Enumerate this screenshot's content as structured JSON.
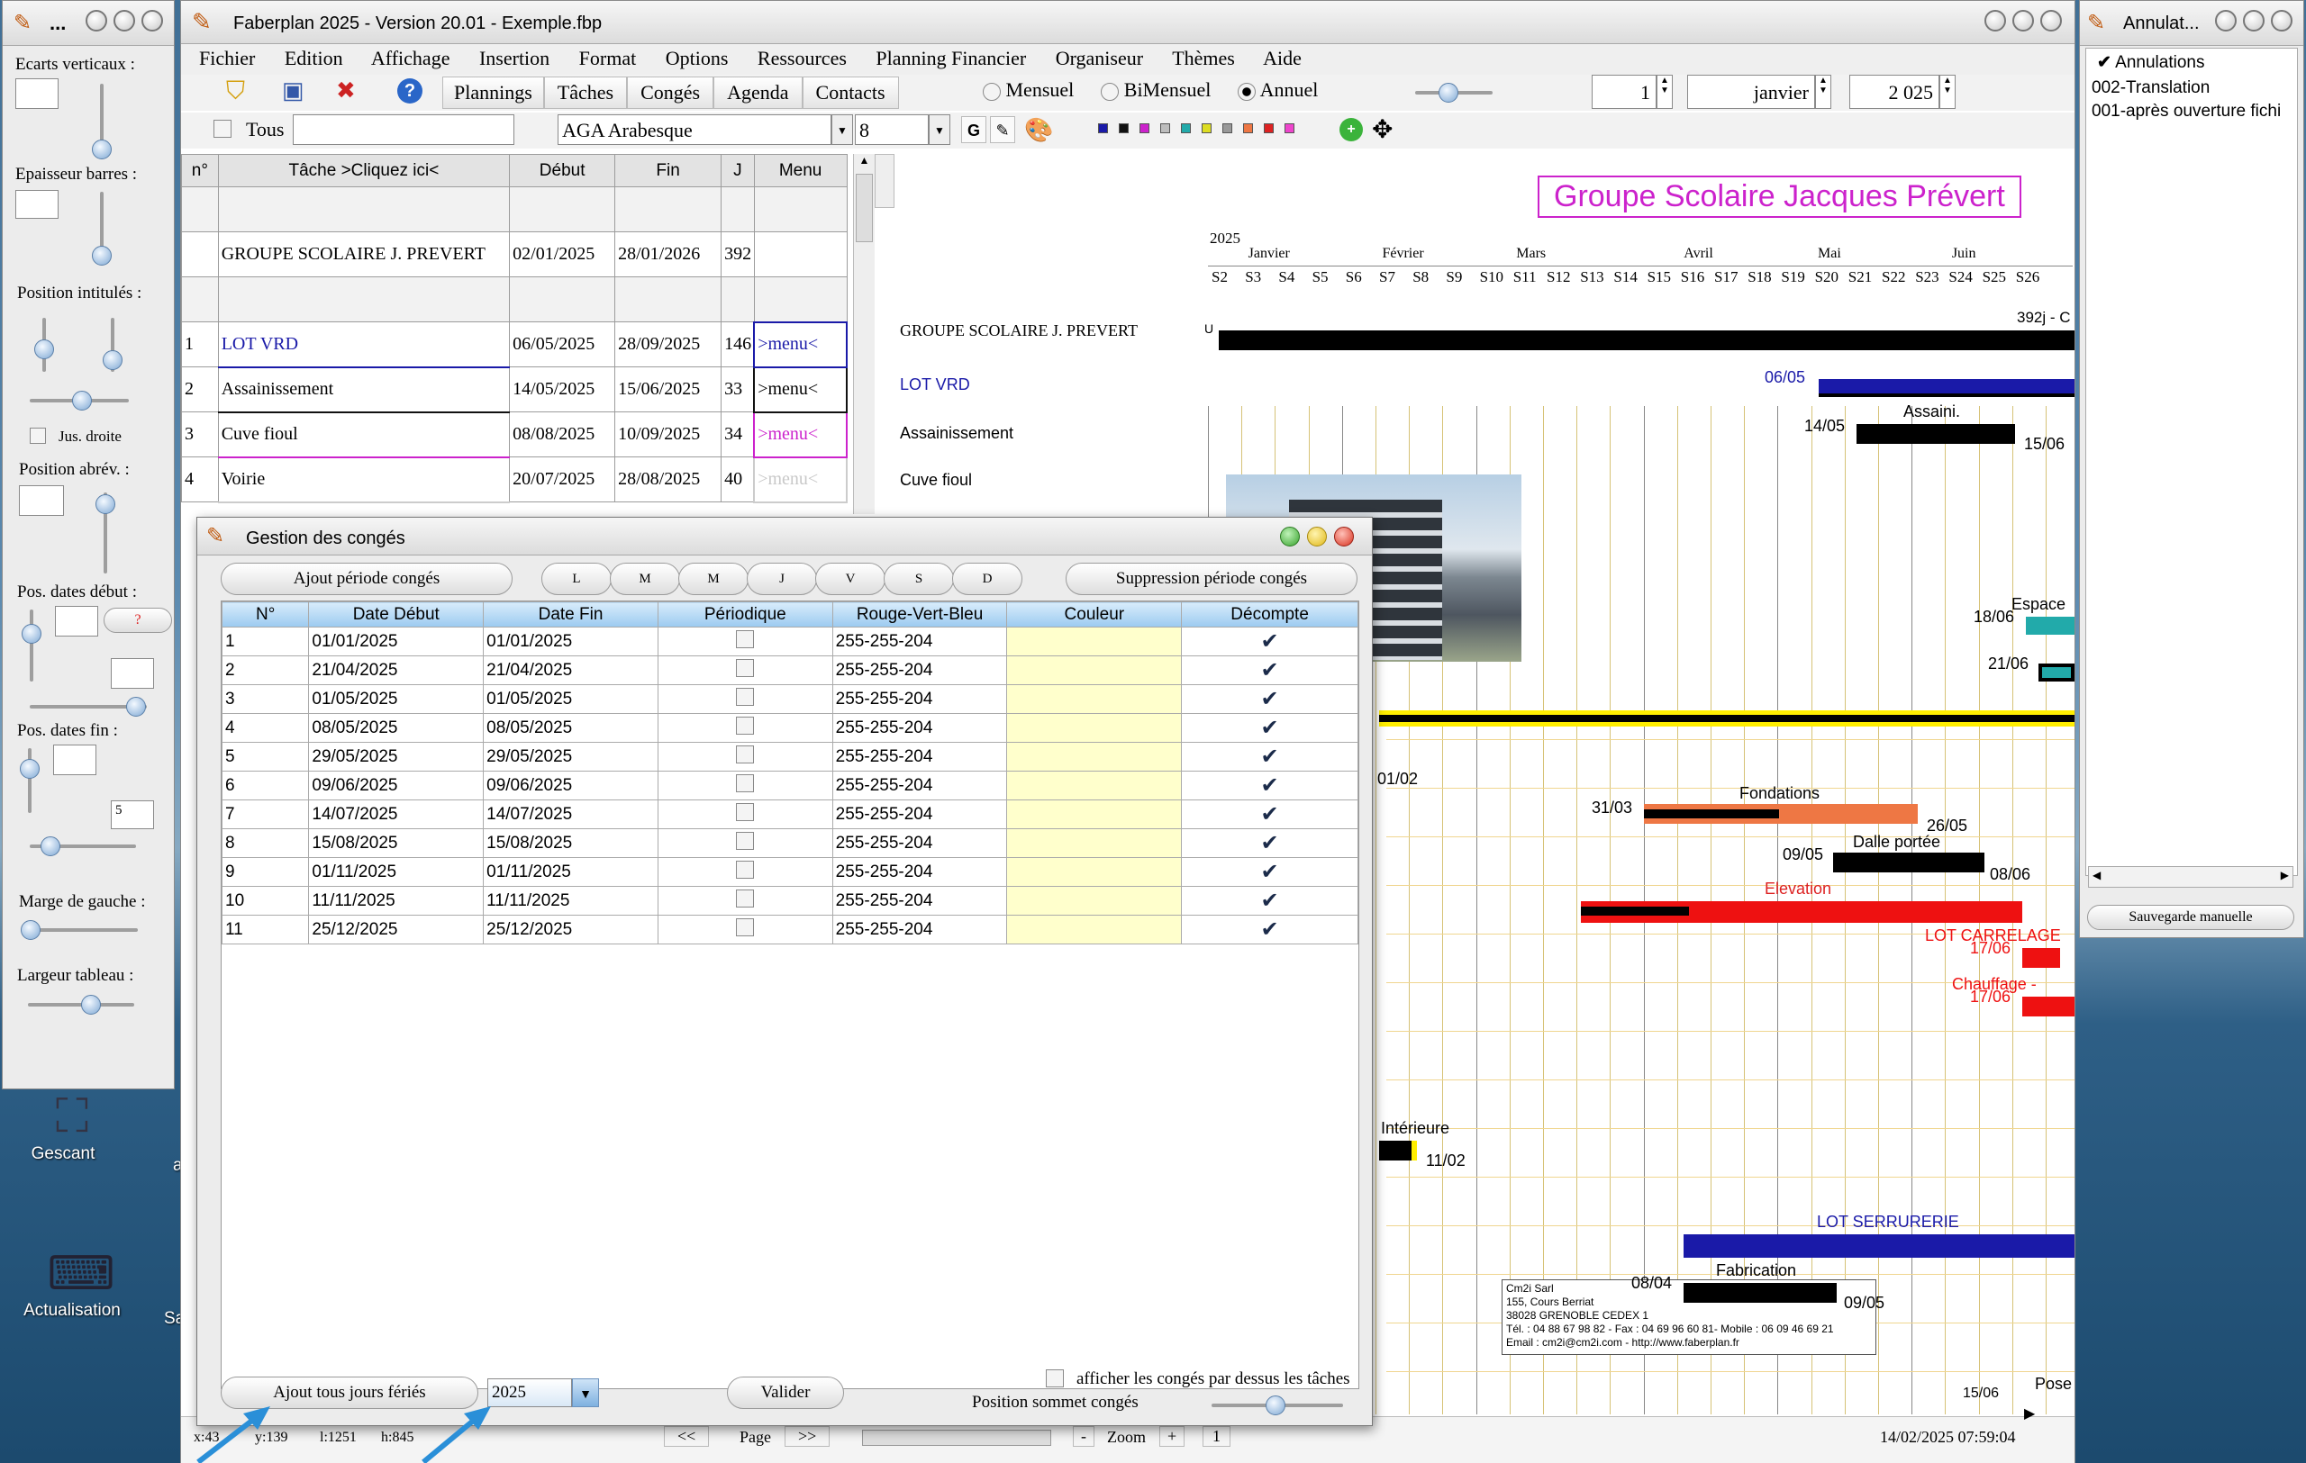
{
  "left_panel": {
    "title": "...",
    "labels": [
      "Ecarts verticaux :",
      "Epaisseur barres :",
      "Position intitulés :",
      "Jus. droite",
      "Position abrév. :",
      "Pos. dates début :",
      "?",
      "Pos. dates fin :",
      "5",
      "Marge de gauche :",
      "Largeur tableau :"
    ]
  },
  "desktop": {
    "icons": [
      "Gescant",
      "Actualisation",
      "Sa",
      "a"
    ]
  },
  "main": {
    "title": "Faberplan 2025 - Version 20.01 - Exemple.fbp",
    "menu": [
      "Fichier",
      "Edition",
      "Affichage",
      "Insertion",
      "Format",
      "Options",
      "Ressources",
      "Planning Financier",
      "Organiseur",
      "Thèmes",
      "Aide"
    ],
    "toolbar1": {
      "buttons": [
        "Plannings",
        "Tâches",
        "Congés",
        "Agenda",
        "Contacts"
      ],
      "radios": [
        "Mensuel",
        "BiMensuel",
        "Annuel"
      ],
      "selected_radio": "Annuel",
      "day": "1",
      "month": "janvier",
      "year": "2 025"
    },
    "toolbar2": {
      "tous": "Tous",
      "font": "AGA Arabesque",
      "size": "8",
      "bold": "G",
      "swatches": [
        "#1a1aa8",
        "#111111",
        "#cc22cc",
        "#bdbdbd",
        "#22aaaa",
        "#dddd22",
        "#999999",
        "#ee7744",
        "#dd2222",
        "#ee44cc"
      ]
    },
    "table": {
      "headers": [
        "n°",
        "Tâche  >Cliquez ici<",
        "Début",
        "Fin",
        "J",
        "Menu"
      ],
      "group": {
        "name": "GROUPE SCOLAIRE J. PREVERT",
        "start": "02/01/2025",
        "end": "28/01/2026",
        "days": "392"
      },
      "rows": [
        {
          "n": "1",
          "name": "LOT VRD",
          "start": "06/05/2025",
          "end": "28/09/2025",
          "days": "146",
          "menu": ">menu<",
          "color": "#1a1aa8",
          "menu_color": "#1a1aa8",
          "border": "#1a1aa8"
        },
        {
          "n": "2",
          "name": "Assainissement",
          "start": "14/05/2025",
          "end": "15/06/2025",
          "days": "33",
          "menu": ">menu<",
          "color": "#000000",
          "menu_color": "#000000",
          "border": "#111111"
        },
        {
          "n": "3",
          "name": "Cuve fioul",
          "start": "08/08/2025",
          "end": "10/09/2025",
          "days": "34",
          "menu": ">menu<",
          "color": "#000000",
          "menu_color": "#cc22cc",
          "border": "#cc22cc"
        },
        {
          "n": "4",
          "name": "Voirie",
          "start": "20/07/2025",
          "end": "28/08/2025",
          "days": "40",
          "menu": ">menu<",
          "color": "#000000",
          "menu_color": "#c8c8c8",
          "border": "#cccccc"
        }
      ]
    },
    "gantt": {
      "title": "Groupe Scolaire Jacques Prévert",
      "year": "2025",
      "months": [
        "Janvier",
        "Février",
        "Mars",
        "Avril",
        "Mai",
        "Juin"
      ],
      "weeks": [
        "S2",
        "S3",
        "S4",
        "S5",
        "S6",
        "S7",
        "S8",
        "S9",
        "S10",
        "S11",
        "S12",
        "S13",
        "S14",
        "S15",
        "S16",
        "S17",
        "S18",
        "S19",
        "S20",
        "S21",
        "S22",
        "S23",
        "S24",
        "S25",
        "S26"
      ],
      "row_labels": [
        "GROUPE SCOLAIRE J. PREVERT",
        "LOT VRD",
        "Assainissement",
        "Cuve fioul"
      ],
      "texts": {
        "duration": "392j - C",
        "vrd_date": "06/05",
        "assain_start": "14/05",
        "assain_name": "Assaini.",
        "assain_end": "15/06",
        "espace": "Espace",
        "d1806": "18/06",
        "d2106": "21/06",
        "d0102": "01/02",
        "fondations": "Fondations",
        "d3103": "31/03",
        "d2605": "26/05",
        "d0905": "09/05",
        "dalle": "Dalle portée",
        "d0806": "08/06",
        "elevation": "Elevation",
        "lot_carrelage": "LOT CARRELAGE",
        "d1706a": "17/06",
        "chauffage": "Chauffage -",
        "d1706b": "17/06",
        "interieure": "Intérieure",
        "d1102": "11/02",
        "lot_serrurerie": "LOT SERRURERIE",
        "fabrication": "Fabrication",
        "d0804": "08/04",
        "d0905b": "09/05",
        "pose": "Pose",
        "d1506": "15/06",
        "u": "U"
      },
      "company": [
        "Cm2i Sarl",
        "155, Cours Berriat",
        "38028 GRENOBLE CEDEX 1",
        "Tél. : 04 88 67 98 82 - Fax : 04 69 96 60 81- Mobile : 06 09 46 69 21",
        "Email : cm2i@cm2i.com - http://www.faberplan.fr"
      ]
    },
    "status": {
      "x": "x:43",
      "y": "y:139",
      "l": "l:1251",
      "h": "h:845",
      "prev": "<<",
      "page": "Page",
      "next": ">>",
      "minus": "-",
      "zoom": "Zoom",
      "plus": "+",
      "zoom_val": "1",
      "datetime": "14/02/2025 07:59:04"
    }
  },
  "dialog": {
    "title": "Gestion des congés",
    "add_period": "Ajout période congés",
    "days": [
      "L",
      "M",
      "M",
      "J",
      "V",
      "S",
      "D"
    ],
    "remove_period": "Suppression période congés",
    "headers": [
      "N°",
      "Date Début",
      "Date Fin",
      "Périodique",
      "Rouge-Vert-Bleu",
      "Couleur",
      "Décompte"
    ],
    "rows": [
      [
        "1",
        "01/01/2025",
        "01/01/2025",
        "255-255-204"
      ],
      [
        "2",
        "21/04/2025",
        "21/04/2025",
        "255-255-204"
      ],
      [
        "3",
        "01/05/2025",
        "01/05/2025",
        "255-255-204"
      ],
      [
        "4",
        "08/05/2025",
        "08/05/2025",
        "255-255-204"
      ],
      [
        "5",
        "29/05/2025",
        "29/05/2025",
        "255-255-204"
      ],
      [
        "6",
        "09/06/2025",
        "09/06/2025",
        "255-255-204"
      ],
      [
        "7",
        "14/07/2025",
        "14/07/2025",
        "255-255-204"
      ],
      [
        "8",
        "15/08/2025",
        "15/08/2025",
        "255-255-204"
      ],
      [
        "9",
        "01/11/2025",
        "01/11/2025",
        "255-255-204"
      ],
      [
        "10",
        "11/11/2025",
        "11/11/2025",
        "255-255-204"
      ],
      [
        "11",
        "25/12/2025",
        "25/12/2025",
        "255-255-204"
      ]
    ],
    "swatch_color": "#ffffcc",
    "add_holidays": "Ajout tous jours fériés",
    "year": "2025",
    "validate": "Valider",
    "overlay_label": "afficher les congés par dessus les tâches",
    "position_label": "Position sommet congés"
  },
  "right_panel": {
    "title": "Annulat...",
    "header": "Annulations",
    "items": [
      "002-Translation",
      "001-après ouverture fichi"
    ],
    "save": "Sauvegarde manuelle"
  }
}
